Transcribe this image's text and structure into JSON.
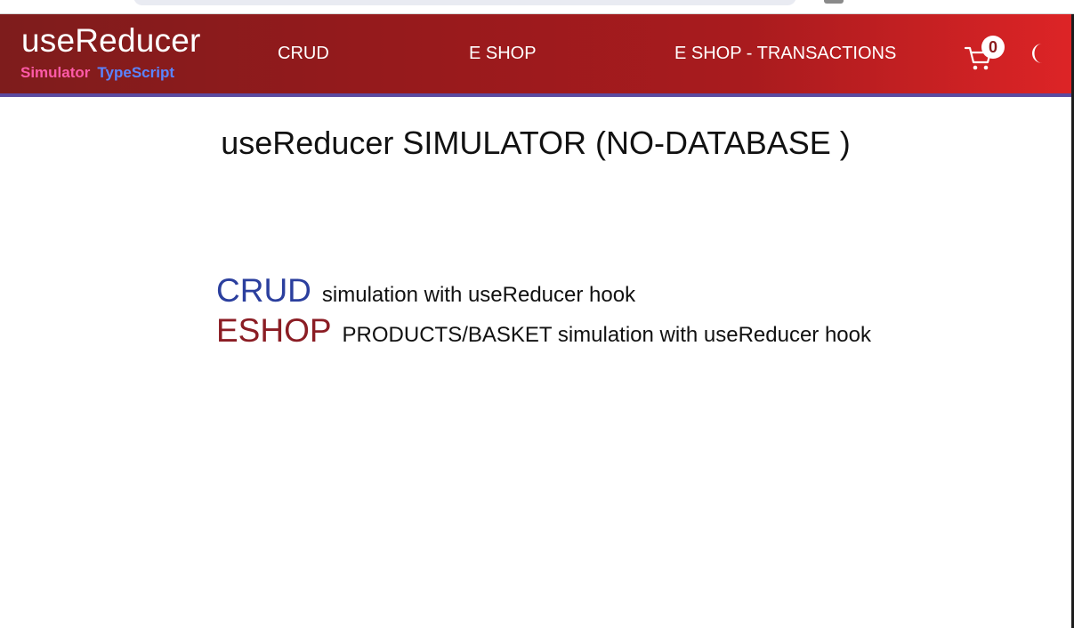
{
  "brand": {
    "title": "useReducer",
    "sub_primary": "Simulator",
    "sub_secondary": "TypeScript"
  },
  "nav": {
    "links": [
      {
        "label": "CRUD"
      },
      {
        "label": "E SHOP"
      },
      {
        "label": "E SHOP - TRANSACTIONS"
      }
    ],
    "cart": {
      "icon": "cart-icon",
      "count": "0"
    },
    "theme": {
      "icon": "moon-icon"
    }
  },
  "main": {
    "title": "useReducer SIMULATOR (NO-DATABASE )",
    "features": [
      {
        "key": "CRUD",
        "desc": "simulation with useReducer hook",
        "color": "#2b3f9e"
      },
      {
        "key": "ESHOP",
        "desc": "PRODUCTS/BASKET simulation with useReducer hook",
        "color": "#8b1d24"
      }
    ]
  },
  "colors": {
    "navbar_start": "#7e1c1c",
    "navbar_end": "#dd2426",
    "navbar_border": "#5b4aa0",
    "brand_simulator": "#ff5aa8",
    "brand_typescript": "#5a84ff"
  }
}
